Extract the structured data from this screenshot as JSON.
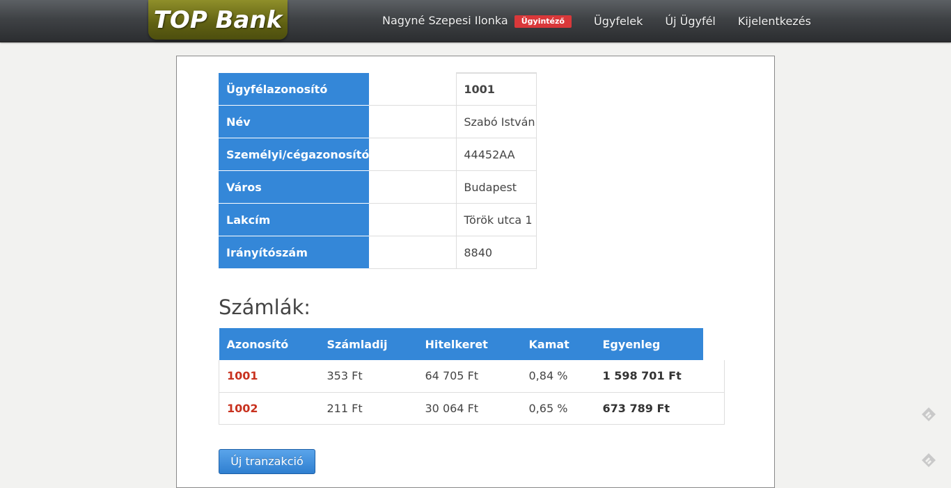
{
  "header": {
    "logo": "TOP Bank",
    "user_name": "Nagyné Szepesi Ilonka",
    "user_role": "Ügyintéző",
    "nav": [
      "Ügyfelek",
      "Új Ügyfél",
      "Kijelentkezés"
    ]
  },
  "customer": {
    "rows": [
      {
        "label": "Ügyfélazonosító",
        "value": "1001"
      },
      {
        "label": "Név",
        "value": "Szabó István"
      },
      {
        "label": "Személyi/cégazonosító",
        "value": "44452AA"
      },
      {
        "label": "Város",
        "value": "Budapest"
      },
      {
        "label": "Lakcím",
        "value": "Török utca 1"
      },
      {
        "label": "Irányítószám",
        "value": "8840"
      }
    ]
  },
  "accounts": {
    "title": "Számlák:",
    "columns": [
      "Azonosító",
      "Számladij",
      "Hitelkeret",
      "Kamat",
      "Egyenleg"
    ],
    "rows": [
      [
        "1001",
        "353 Ft",
        "64 705 Ft",
        "0,84 %",
        "1 598 701 Ft"
      ],
      [
        "1002",
        "211 Ft",
        "30 064 Ft",
        "0,65 %",
        "673 789 Ft"
      ]
    ]
  },
  "actions": {
    "new_transaction": "Új tranzakció"
  },
  "colors": {
    "accent": "#3487d8",
    "link": "#c8321f",
    "badge": "#d9383a",
    "logo": "#6b6c16"
  },
  "icons": [
    "feedly-icon",
    "feedly-icon"
  ]
}
